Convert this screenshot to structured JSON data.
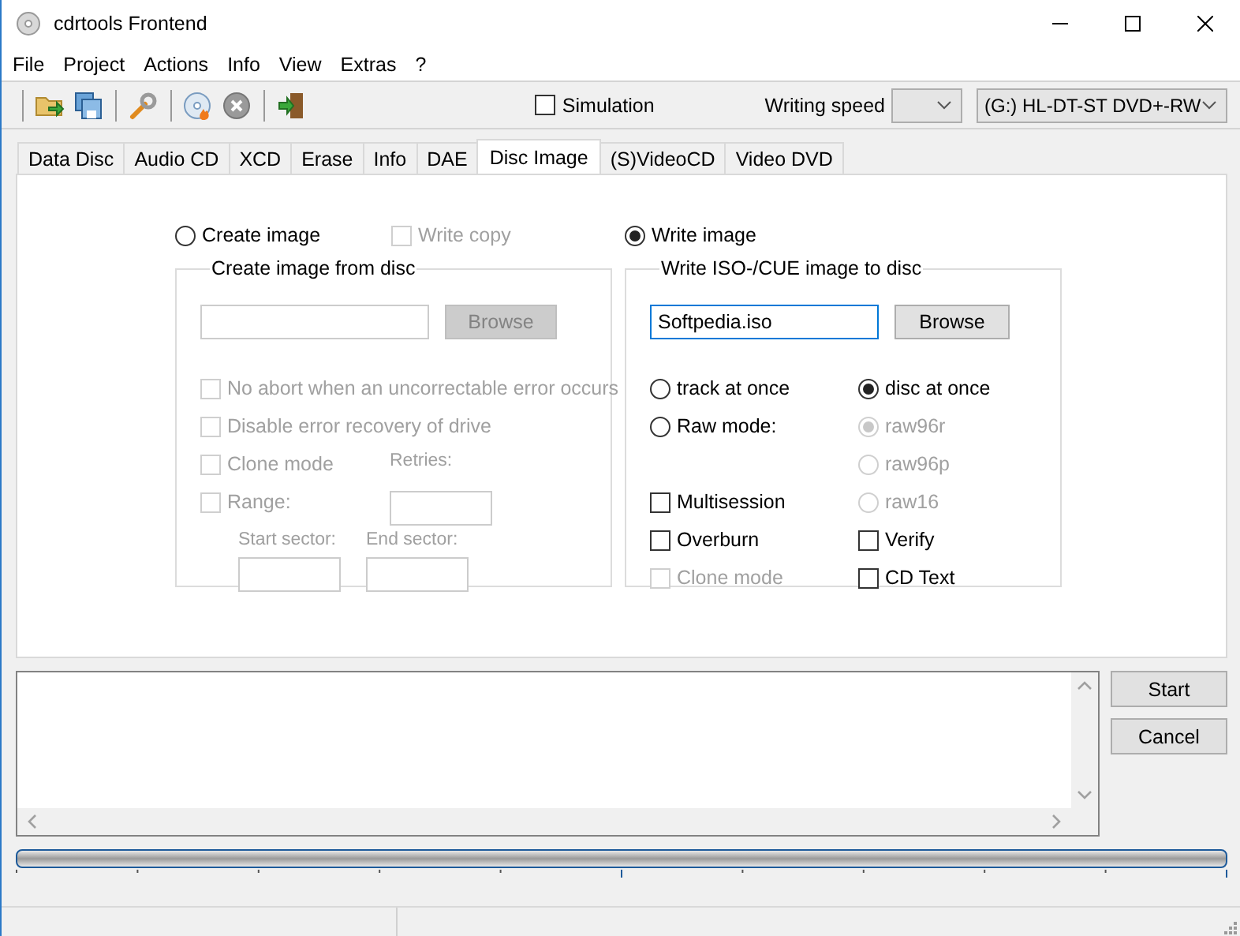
{
  "window": {
    "title": "cdrtools Frontend"
  },
  "menu": [
    "File",
    "Project",
    "Actions",
    "Info",
    "View",
    "Extras",
    "?"
  ],
  "toolbar": {
    "simulation": {
      "label": "Simulation",
      "checked": false
    },
    "writing_speed": {
      "label": "Writing speed"
    },
    "drive": {
      "value": "(G:) HL-DT-ST DVD+-RW"
    }
  },
  "tabs": [
    {
      "label": "Data Disc",
      "selected": false
    },
    {
      "label": "Audio CD",
      "selected": false
    },
    {
      "label": "XCD",
      "selected": false
    },
    {
      "label": "Erase",
      "selected": false
    },
    {
      "label": "Info",
      "selected": false
    },
    {
      "label": "DAE",
      "selected": false
    },
    {
      "label": "Disc Image",
      "selected": true
    },
    {
      "label": "(S)VideoCD",
      "selected": false
    },
    {
      "label": "Video DVD",
      "selected": false
    }
  ],
  "mode_options": [
    {
      "kind": "radio",
      "label": "Create image",
      "selected": false,
      "disabled": false
    },
    {
      "kind": "checkbox",
      "label": "Write copy",
      "checked": false,
      "disabled": true
    },
    {
      "kind": "radio",
      "label": "Write image",
      "selected": true,
      "disabled": false
    }
  ],
  "create_group": {
    "title": "Create image from disc",
    "browse": {
      "label": "Browse",
      "disabled": true
    },
    "options": [
      {
        "kind": "checkbox",
        "label": "No abort when an uncorrectable error occurs",
        "checked": false,
        "disabled": true
      },
      {
        "kind": "checkbox",
        "label": "Disable error recovery of drive",
        "checked": false,
        "disabled": true
      },
      {
        "kind": "checkbox",
        "label": "Clone mode",
        "checked": false,
        "disabled": true
      },
      {
        "kind": "checkbox",
        "label": "Range:",
        "checked": false,
        "disabled": true
      }
    ],
    "retries": {
      "label": "Retries:"
    },
    "start_sector": {
      "label": "Start sector:"
    },
    "end_sector": {
      "label": "End sector:"
    }
  },
  "write_group": {
    "title": "Write ISO-/CUE image to disc",
    "file_field": {
      "value": "Softpedia.iso"
    },
    "browse": {
      "label": "Browse",
      "disabled": false
    },
    "left_column": [
      {
        "kind": "radio",
        "label": "track at once",
        "selected": false,
        "disabled": false
      },
      {
        "kind": "radio",
        "label": "Raw mode:",
        "selected": false,
        "disabled": false
      },
      {
        "kind": "checkbox",
        "label": "Multisession",
        "checked": false,
        "disabled": false
      },
      {
        "kind": "checkbox",
        "label": "Overburn",
        "checked": false,
        "disabled": false
      },
      {
        "kind": "checkbox",
        "label": "Clone mode",
        "checked": false,
        "disabled": true
      }
    ],
    "right_column": [
      {
        "kind": "radio",
        "label": "disc at once",
        "selected": true,
        "disabled": false
      },
      {
        "kind": "radio",
        "label": "raw96r",
        "selected": true,
        "disabled": true
      },
      {
        "kind": "radio",
        "label": "raw96p",
        "selected": false,
        "disabled": true
      },
      {
        "kind": "radio",
        "label": "raw16",
        "selected": false,
        "disabled": true
      },
      {
        "kind": "checkbox",
        "label": "Verify",
        "checked": false,
        "disabled": false
      },
      {
        "kind": "checkbox",
        "label": "CD Text",
        "checked": false,
        "disabled": false
      }
    ]
  },
  "buttons": [
    {
      "label": "Start"
    },
    {
      "label": "Cancel"
    }
  ]
}
